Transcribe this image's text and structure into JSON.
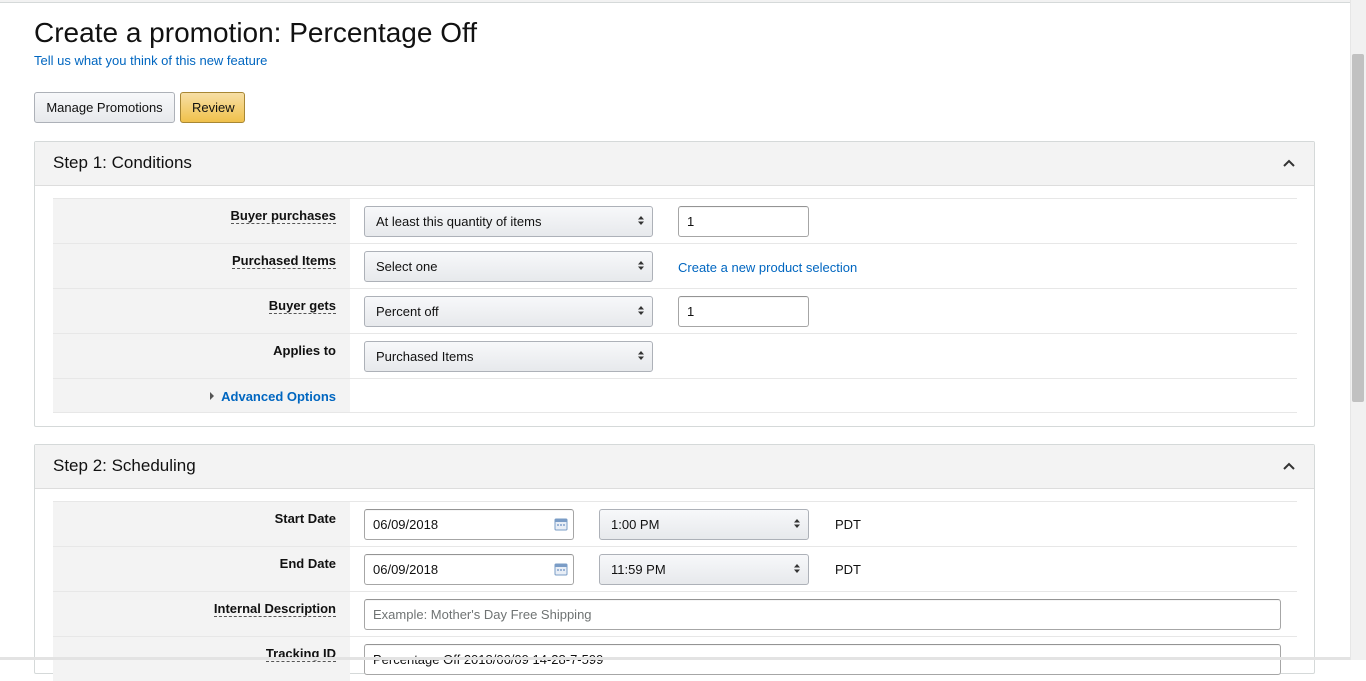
{
  "page": {
    "title": "Create a promotion: Percentage Off",
    "feedback_link": "Tell us what you think of this new feature"
  },
  "toolbar": {
    "manage_label": "Manage Promotions",
    "review_label": "Review"
  },
  "step1": {
    "title": "Step 1: Conditions",
    "rows": {
      "buyer_purchases": {
        "label": "Buyer purchases",
        "select": "At least this quantity of items",
        "value": "1"
      },
      "purchased_items": {
        "label": "Purchased Items",
        "select": "Select one",
        "link": "Create a new product selection"
      },
      "buyer_gets": {
        "label": "Buyer gets",
        "select": "Percent off",
        "value": "1"
      },
      "applies_to": {
        "label": "Applies to",
        "select": "Purchased Items"
      }
    },
    "advanced_options": "Advanced Options"
  },
  "step2": {
    "title": "Step 2: Scheduling",
    "rows": {
      "start_date": {
        "label": "Start Date",
        "date": "06/09/2018",
        "time": "1:00 PM",
        "tz": "PDT"
      },
      "end_date": {
        "label": "End Date",
        "date": "06/09/2018",
        "time": "11:59 PM",
        "tz": "PDT"
      },
      "internal_description": {
        "label": "Internal Description",
        "placeholder": "Example: Mother's Day Free Shipping"
      },
      "tracking_id": {
        "label": "Tracking ID",
        "value": "Percentage Off 2018/06/09 14-28-7-599"
      }
    }
  },
  "colors": {
    "link": "#0066c0",
    "review_button": "#f0c14b",
    "panel_header": "#f3f3f3"
  },
  "icons": {
    "collapse": "chevron-up-icon",
    "calendar": "calendar-icon",
    "select_arrow": "up-down-arrow-icon",
    "expand": "caret-right-icon"
  }
}
